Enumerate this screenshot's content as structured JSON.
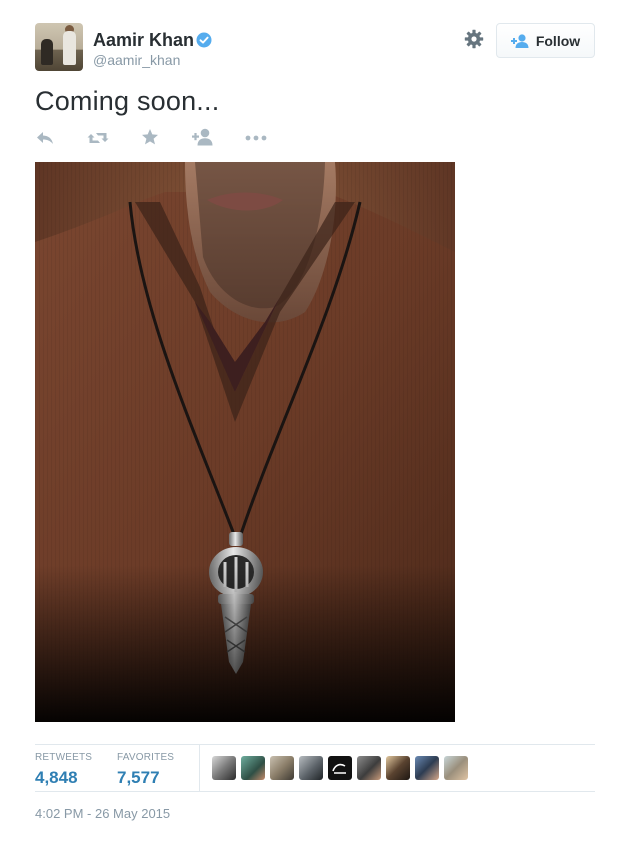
{
  "user": {
    "name": "Aamir Khan",
    "handle": "@aamir_khan",
    "verified": true
  },
  "header": {
    "follow_label": "Follow",
    "settings_icon": "gear-icon",
    "follow_icon": "add-user-icon"
  },
  "tweet": {
    "text": "Coming soon...",
    "timestamp": "4:02 PM - 26 May 2015"
  },
  "actions": [
    {
      "name": "reply",
      "icon": "reply-icon"
    },
    {
      "name": "retweet",
      "icon": "retweet-icon"
    },
    {
      "name": "favorite",
      "icon": "star-icon"
    },
    {
      "name": "follow",
      "icon": "add-user-icon"
    },
    {
      "name": "more",
      "icon": "more-dots-icon"
    }
  ],
  "stats": {
    "retweets_label": "RETWEETS",
    "retweets_value": "4,848",
    "favorites_label": "FAVORITES",
    "favorites_value": "7,577"
  },
  "colors": {
    "link_blue": "#2f7fb3",
    "muted_text": "#8899a6",
    "verified_blue": "#55acee",
    "icon_gray": "#aab8c2"
  }
}
